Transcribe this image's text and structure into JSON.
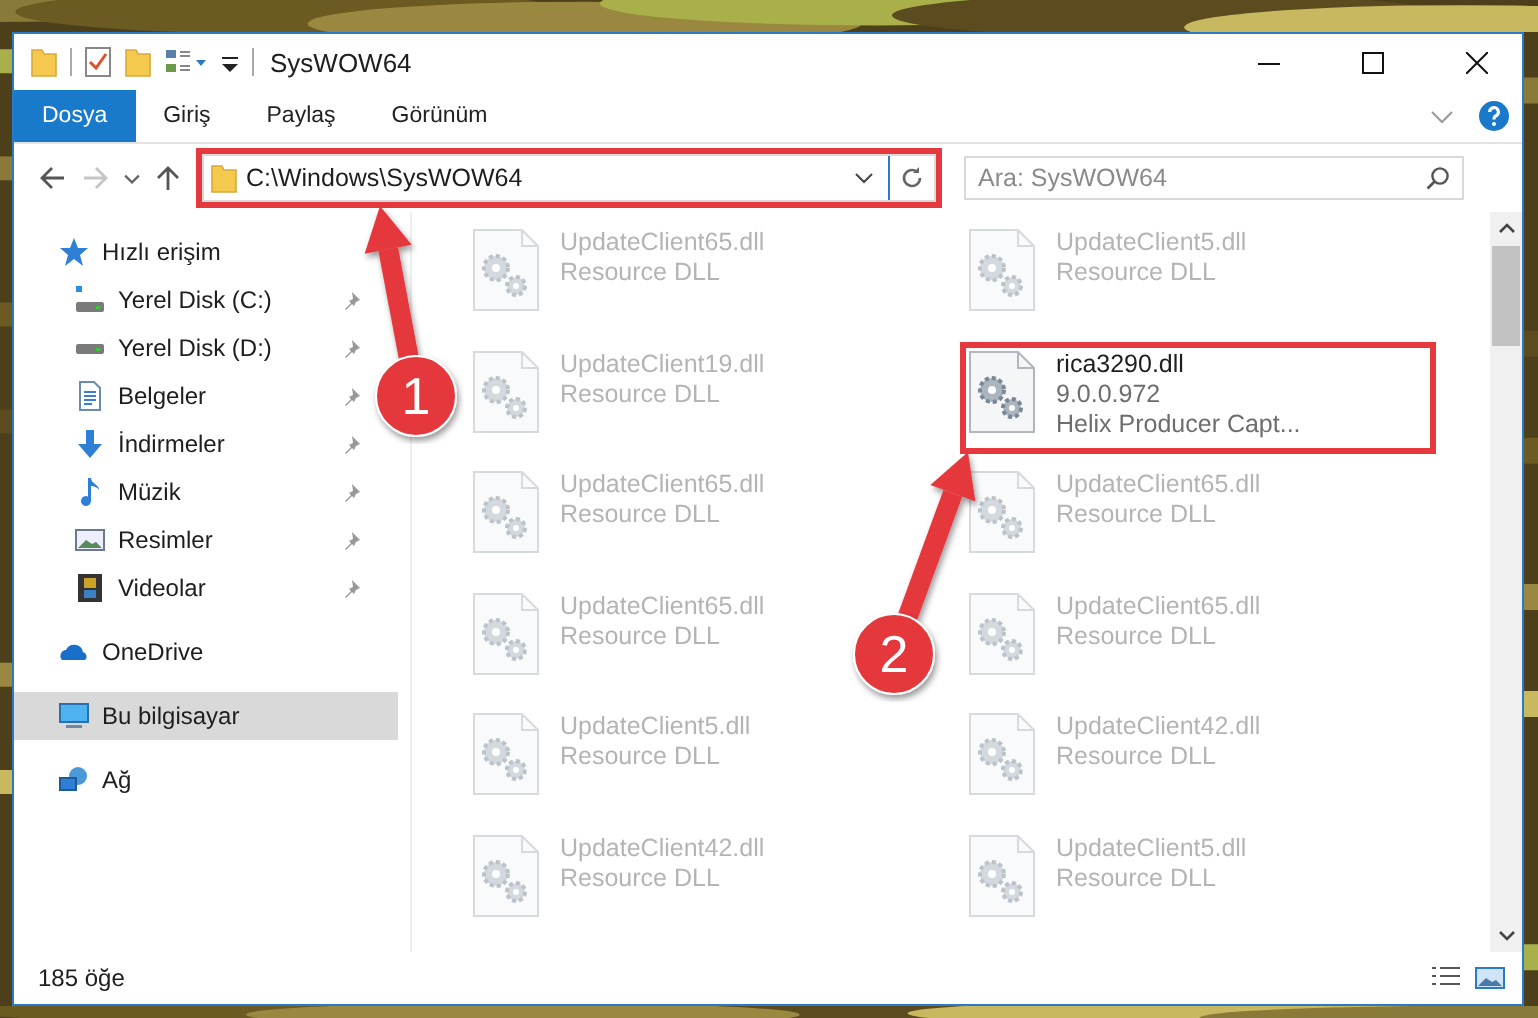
{
  "window": {
    "title": "SysWOW64"
  },
  "ribbon_tabs": [
    {
      "label": "Dosya",
      "selected": true
    },
    {
      "label": "Giriş",
      "selected": false
    },
    {
      "label": "Paylaş",
      "selected": false
    },
    {
      "label": "Görünüm",
      "selected": false
    }
  ],
  "address": {
    "path": "C:\\Windows\\SysWOW64",
    "highlighted": true
  },
  "search": {
    "placeholder": "Ara: SysWOW64"
  },
  "nav": [
    {
      "label": "Hızlı erişim",
      "kind": "star",
      "selected": false,
      "children": [
        {
          "label": "Yerel Disk (C:)",
          "kind": "drive-c",
          "pinned": true,
          "selected": false
        },
        {
          "label": "Yerel Disk (D:)",
          "kind": "drive",
          "pinned": true,
          "selected": false
        },
        {
          "label": "Belgeler",
          "kind": "docs",
          "pinned": true,
          "selected": false
        },
        {
          "label": "İndirmeler",
          "kind": "download",
          "pinned": true,
          "selected": false
        },
        {
          "label": "Müzik",
          "kind": "music",
          "pinned": true,
          "selected": false
        },
        {
          "label": "Resimler",
          "kind": "pictures",
          "pinned": true,
          "selected": false
        },
        {
          "label": "Videolar",
          "kind": "videos",
          "pinned": true,
          "selected": false
        }
      ]
    },
    {
      "label": "OneDrive",
      "kind": "cloud",
      "selected": false
    },
    {
      "label": "Bu bilgisayar",
      "kind": "pc",
      "selected": true
    },
    {
      "label": "Ağ",
      "kind": "network",
      "selected": false
    }
  ],
  "files": [
    {
      "name": "UpdateClient65.dll",
      "lines": [
        "Resource DLL"
      ],
      "dimmed": true,
      "highlighted": false
    },
    {
      "name": "UpdateClient5.dll",
      "lines": [
        "Resource DLL"
      ],
      "dimmed": true,
      "highlighted": false
    },
    {
      "name": "UpdateClient19.dll",
      "lines": [
        "Resource DLL"
      ],
      "dimmed": true,
      "highlighted": false
    },
    {
      "name": "rica3290.dll",
      "lines": [
        "9.0.0.972",
        "Helix Producer Capt..."
      ],
      "dimmed": false,
      "highlighted": true
    },
    {
      "name": "UpdateClient65.dll",
      "lines": [
        "Resource DLL"
      ],
      "dimmed": true,
      "highlighted": false
    },
    {
      "name": "UpdateClient65.dll",
      "lines": [
        "Resource DLL"
      ],
      "dimmed": true,
      "highlighted": false
    },
    {
      "name": "UpdateClient65.dll",
      "lines": [
        "Resource DLL"
      ],
      "dimmed": true,
      "highlighted": false
    },
    {
      "name": "UpdateClient65.dll",
      "lines": [
        "Resource DLL"
      ],
      "dimmed": true,
      "highlighted": false
    },
    {
      "name": "UpdateClient5.dll",
      "lines": [
        "Resource DLL"
      ],
      "dimmed": true,
      "highlighted": false
    },
    {
      "name": "UpdateClient42.dll",
      "lines": [
        "Resource DLL"
      ],
      "dimmed": true,
      "highlighted": false
    },
    {
      "name": "UpdateClient42.dll",
      "lines": [
        "Resource DLL"
      ],
      "dimmed": true,
      "highlighted": false
    },
    {
      "name": "UpdateClient5.dll",
      "lines": [
        "Resource DLL"
      ],
      "dimmed": true,
      "highlighted": false
    }
  ],
  "status_bar": {
    "count": "185 öğe"
  },
  "callouts": [
    {
      "number": "1"
    },
    {
      "number": "2"
    }
  ]
}
